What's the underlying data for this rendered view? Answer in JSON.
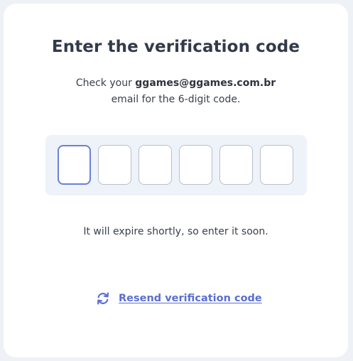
{
  "verification": {
    "title": "Enter the verification code",
    "instruction_prefix": "Check your",
    "email": "ggames@ggames.com.br",
    "instruction_suffix": "email for the 6-digit code.",
    "code_digits": [
      "",
      "",
      "",
      "",
      "",
      ""
    ],
    "expire_notice": "It will expire shortly, so enter it soon.",
    "resend_label": "Resend verification code",
    "resend_icon": "refresh-icon"
  },
  "colors": {
    "accent": "#5a6fcf",
    "active_border": "#6b80d6",
    "panel_background": "#eef2f9",
    "text_primary": "#333a48"
  }
}
